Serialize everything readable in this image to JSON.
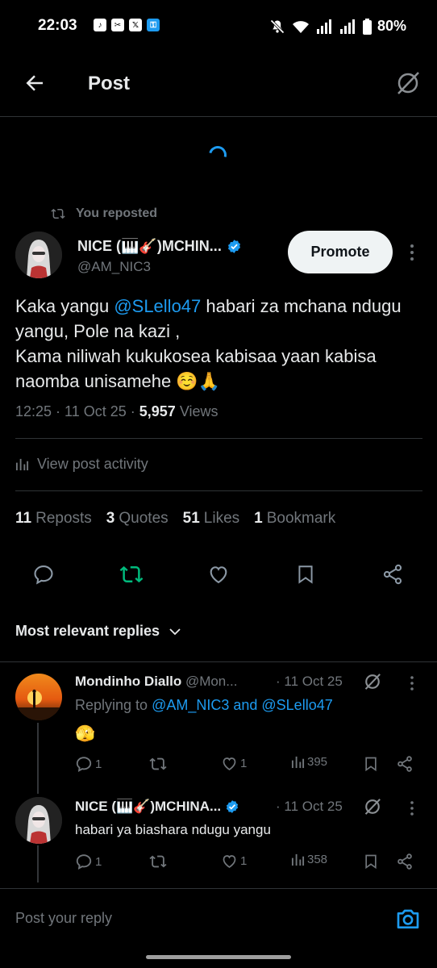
{
  "status_bar": {
    "time": "22:03",
    "app_icons": [
      "tiktok-icon",
      "capcut-icon",
      "x-icon",
      "key-icon"
    ],
    "battery": "80%"
  },
  "header": {
    "title": "Post",
    "back_icon": "back-arrow-icon",
    "grok_icon": "grok-icon"
  },
  "post": {
    "repost_label": "You reposted",
    "author_name": "NICE (🎹🎸)MCHIN...",
    "author_handle": "@AM_NIC3",
    "verified": true,
    "promote_label": "Promote",
    "text_part1": "Kaka yangu ",
    "mention": "@SLello47",
    "text_part2": "  habari za mchana ndugu yangu, Pole na kazi ,",
    "text_line3": "Kama niliwah kukukosea kabisaa yaan kabisa naomba unisamehe ☺️🙏",
    "time": "12:25",
    "date": "11 Oct 25",
    "views_count": "5,957",
    "views_label": "Views",
    "activity_label": "View post activity",
    "stats": {
      "reposts_count": "11",
      "reposts_label": "Reposts",
      "quotes_count": "3",
      "quotes_label": "Quotes",
      "likes_count": "51",
      "likes_label": "Likes",
      "bookmarks_count": "1",
      "bookmarks_label": "Bookmark"
    }
  },
  "colors": {
    "accent": "#1d9bf0",
    "repost_active": "#00ba7c",
    "muted": "#71767b",
    "text": "#e7e9ea",
    "background": "#000000"
  },
  "replies_sort": "Most relevant replies",
  "replies": [
    {
      "name": "Mondinho Diallo",
      "handle": "@Mon...",
      "date": "· 11 Oct 25",
      "replying_prefix": "Replying to ",
      "replying_to": "@AM_NIC3 and @SLello47",
      "text": "🫣",
      "replies_count": "1",
      "reposts_count": "",
      "likes_count": "1",
      "views_count": "395"
    },
    {
      "name": "NICE (🎹🎸)MCHINA...",
      "date": "· 11 Oct 25",
      "verified": true,
      "text": "habari ya biashara ndugu yangu",
      "replies_count": "1",
      "reposts_count": "",
      "likes_count": "1",
      "views_count": "358"
    }
  ],
  "composer": {
    "placeholder": "Post your reply",
    "camera_icon": "camera-icon"
  }
}
